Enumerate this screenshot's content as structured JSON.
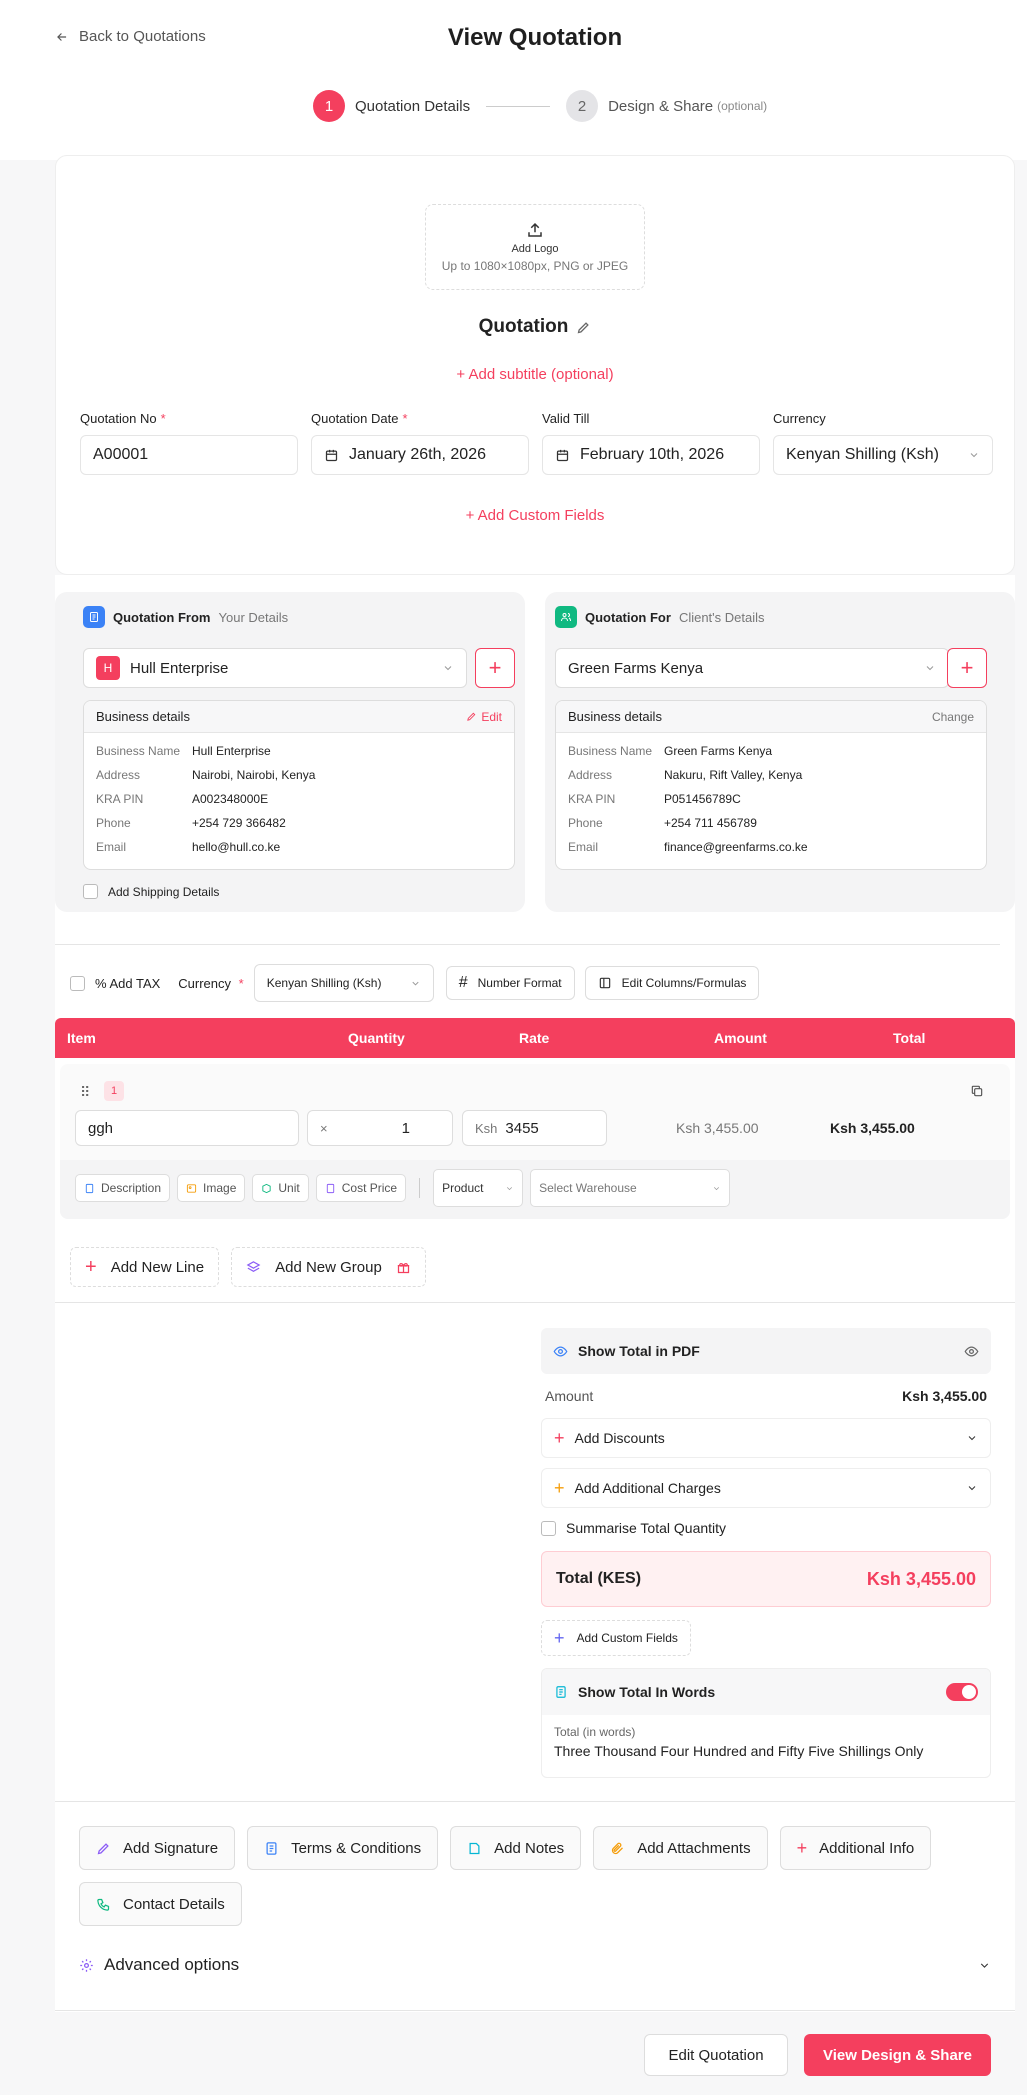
{
  "header": {
    "back": "Back to Quotations",
    "title": "View Quotation"
  },
  "steps": [
    {
      "num": "1",
      "label": "Quotation Details",
      "note": ""
    },
    {
      "num": "2",
      "label": "Design & Share",
      "note": "(optional)"
    }
  ],
  "logo": {
    "title": "Add Logo",
    "hint": "Up to 1080×1080px, PNG or JPEG"
  },
  "doc": {
    "title": "Quotation",
    "subtitle_link": "+ Add subtitle (optional)",
    "custom_fields_link": "+ Add Custom Fields"
  },
  "fields": {
    "quotation_no": {
      "label": "Quotation No",
      "value": "A00001",
      "req": "*"
    },
    "quotation_date": {
      "label": "Quotation Date",
      "value": "January 26th, 2026",
      "req": "*"
    },
    "valid_till": {
      "label": "Valid Till",
      "value": "February 10th, 2026"
    },
    "currency": {
      "label": "Currency",
      "value": "Kenyan Shilling (Ksh)"
    }
  },
  "from": {
    "title": "Quotation From",
    "sub": "Your Details",
    "selected": "Hull Enterprise",
    "avatar": "H",
    "details_title": "Business details",
    "action": "Edit",
    "rows": [
      {
        "k": "Business Name",
        "v": "Hull Enterprise"
      },
      {
        "k": "Address",
        "v": "Nairobi, Nairobi, Kenya"
      },
      {
        "k": "KRA PIN",
        "v": "A002348000E"
      },
      {
        "k": "Phone",
        "v": "+254 729 366482"
      },
      {
        "k": "Email",
        "v": "hello@hull.co.ke"
      }
    ],
    "shipping": "Add Shipping Details"
  },
  "to": {
    "title": "Quotation For",
    "sub": "Client's Details",
    "selected": "Green Farms Kenya",
    "details_title": "Business details",
    "action": "Change",
    "rows": [
      {
        "k": "Business Name",
        "v": "Green Farms Kenya"
      },
      {
        "k": "Address",
        "v": "Nakuru, Rift Valley, Kenya"
      },
      {
        "k": "KRA PIN",
        "v": "P051456789C"
      },
      {
        "k": "Phone",
        "v": "+254 711 456789"
      },
      {
        "k": "Email",
        "v": "finance@greenfarms.co.ke"
      }
    ]
  },
  "toolbar": {
    "tax": "% Add TAX",
    "currency_label": "Currency",
    "req": "*",
    "currency": "Kenyan Shilling (Ksh)",
    "number_format": "Number Format",
    "edit_columns": "Edit Columns/Formulas"
  },
  "table": {
    "headers": {
      "item": "Item",
      "quantity": "Quantity",
      "rate": "Rate",
      "amount": "Amount",
      "total": "Total"
    },
    "line": {
      "index": "1",
      "item": "ggh",
      "times": "×",
      "qty": "1",
      "currency": "Ksh",
      "rate": "3455",
      "amount": "Ksh 3,455.00",
      "total": "Ksh 3,455.00"
    },
    "chips": [
      "Description",
      "Image",
      "Unit",
      "Cost Price"
    ],
    "product": "Product",
    "warehouse": "Select Warehouse",
    "add_line": "Add New Line",
    "add_group": "Add New Group"
  },
  "summary": {
    "show_total_pdf": "Show Total in PDF",
    "amount_label": "Amount",
    "amount": "Ksh 3,455.00",
    "discounts": "Add Discounts",
    "charges": "Add Additional Charges",
    "summarise_qty": "Summarise Total Quantity",
    "total_label": "Total (KES)",
    "total": "Ksh 3,455.00",
    "custom_fields": "Add Custom Fields",
    "words_title": "Show Total In Words",
    "words_label": "Total (in words)",
    "words": "Three Thousand Four Hundred and Fifty Five Shillings Only"
  },
  "extras": [
    "Add Signature",
    "Terms & Conditions",
    "Add Notes",
    "Add Attachments",
    "Additional Info",
    "Contact Details"
  ],
  "advanced": "Advanced options",
  "footer": {
    "edit": "Edit Quotation",
    "view": "View Design & Share"
  },
  "colors": {
    "accent": "#f43f5e",
    "blue": "#3b82f6",
    "green": "#10b981"
  }
}
